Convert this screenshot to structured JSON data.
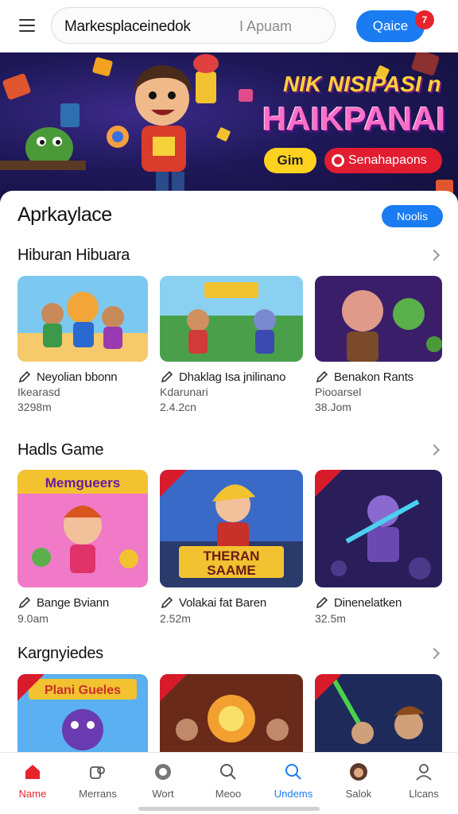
{
  "header": {
    "title": "Markesplaceinedok",
    "search_placeholder": "I Apuam",
    "cta_label": "Qaice",
    "badge_count": "7"
  },
  "hero": {
    "line1": "NIK NISIPASI n",
    "line2": "HAIKPANAI",
    "button_primary": "Gim",
    "button_secondary": "Senahapaons"
  },
  "page": {
    "title": "Aprkaylace",
    "pill_label": "Noolis"
  },
  "sections": [
    {
      "title": "Hiburan Hibuara",
      "cards": [
        {
          "name": "Neyolian bbonn",
          "sub": "Ikearasd",
          "meta": "3298m"
        },
        {
          "name": "Dhaklag Isa jnilinano",
          "sub": "Kdarunari",
          "meta": "2.4.2cn"
        },
        {
          "name": "Benakon Rants",
          "sub": "Piooarsel",
          "meta": "38.Jom"
        }
      ]
    },
    {
      "title": "Hadls Game",
      "cards": [
        {
          "name": "Bange Bviann",
          "sub": "",
          "meta": "9.0am",
          "art_text": "Memgueers"
        },
        {
          "name": "Volakai fat Baren",
          "sub": "",
          "meta": "2.52m",
          "art_text": "THERAN SAAME"
        },
        {
          "name": "Dinenelatken",
          "sub": "",
          "meta": "32.5m"
        }
      ]
    },
    {
      "title": "Kargnyiedes",
      "cards": [
        {
          "art_text": "Plani Gueles"
        },
        {},
        {}
      ]
    }
  ],
  "bottom_nav": [
    {
      "label": "Name",
      "icon": "home-icon",
      "active": true
    },
    {
      "label": "Merrans",
      "icon": "people-icon"
    },
    {
      "label": "Wort",
      "icon": "globe-icon"
    },
    {
      "label": "Meoo",
      "icon": "search-icon"
    },
    {
      "label": "Undems",
      "icon": "user-search-icon"
    },
    {
      "label": "Salok",
      "icon": "avatar-icon"
    },
    {
      "label": "Llcans",
      "icon": "profile-icon"
    }
  ],
  "colors": {
    "accent": "#1b7cf2",
    "badge": "#e8232b",
    "nav_active": "#e8232b",
    "nav_highlight": "#1b7cf2"
  }
}
